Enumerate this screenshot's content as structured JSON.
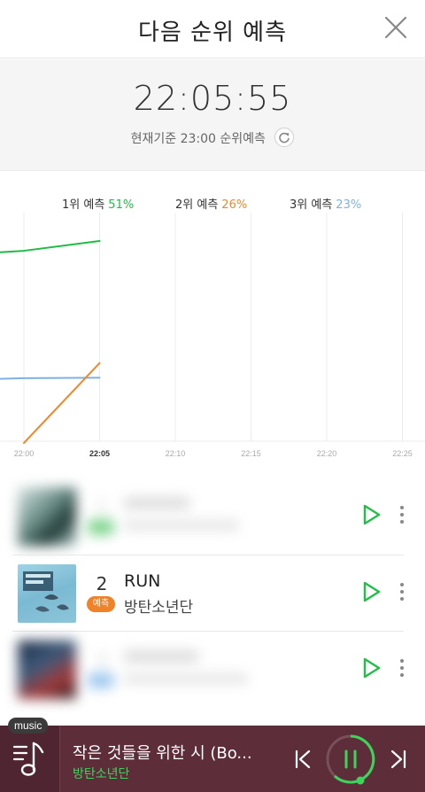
{
  "header": {
    "title": "다음 순위 예측"
  },
  "clock": {
    "time": "22:05:55",
    "basis": "현재기준 23:00 순위예측"
  },
  "legend": [
    {
      "label": "1위 예측",
      "pct": "51%",
      "color": "#1fbb45"
    },
    {
      "label": "2위 예측",
      "pct": "26%",
      "color": "#f0892b"
    },
    {
      "label": "3위 예측",
      "pct": "23%",
      "color": "#7fb1e3"
    }
  ],
  "chart_data": {
    "type": "line",
    "x": [
      "21:55",
      "22:00",
      "22:05"
    ],
    "x_ticks": [
      "22:00",
      "22:05",
      "22:10",
      "22:15",
      "22:20",
      "22:25"
    ],
    "series": [
      {
        "name": "1위 예측",
        "values": [
          48,
          49,
          51
        ],
        "color": "#1fbb45"
      },
      {
        "name": "3위 예측",
        "values": [
          22.5,
          22.9,
          23
        ],
        "color": "#7fb1e3"
      },
      {
        "name": "2위 예측",
        "values": [
          10,
          10,
          26
        ],
        "color": "#f0892b"
      }
    ],
    "ylim": [
      10,
      55
    ],
    "grid": "vertical"
  },
  "chart": {
    "ticks": [
      "22:00",
      "22:05",
      "22:10",
      "22:15",
      "22:20",
      "22:25"
    ]
  },
  "rows": [
    {
      "rank": "",
      "title": "",
      "artist": "",
      "badge": ""
    },
    {
      "rank": "2",
      "title": "RUN",
      "artist": "방탄소년단",
      "badge": "예측"
    },
    {
      "rank": "",
      "title": "",
      "artist": "",
      "badge": ""
    }
  ],
  "player": {
    "tag": "music",
    "title": "작은 것들을 위한 시 (Bo...",
    "artist": "방탄소년단",
    "accent": "#3ad65b",
    "background": "#5d2d3a"
  }
}
